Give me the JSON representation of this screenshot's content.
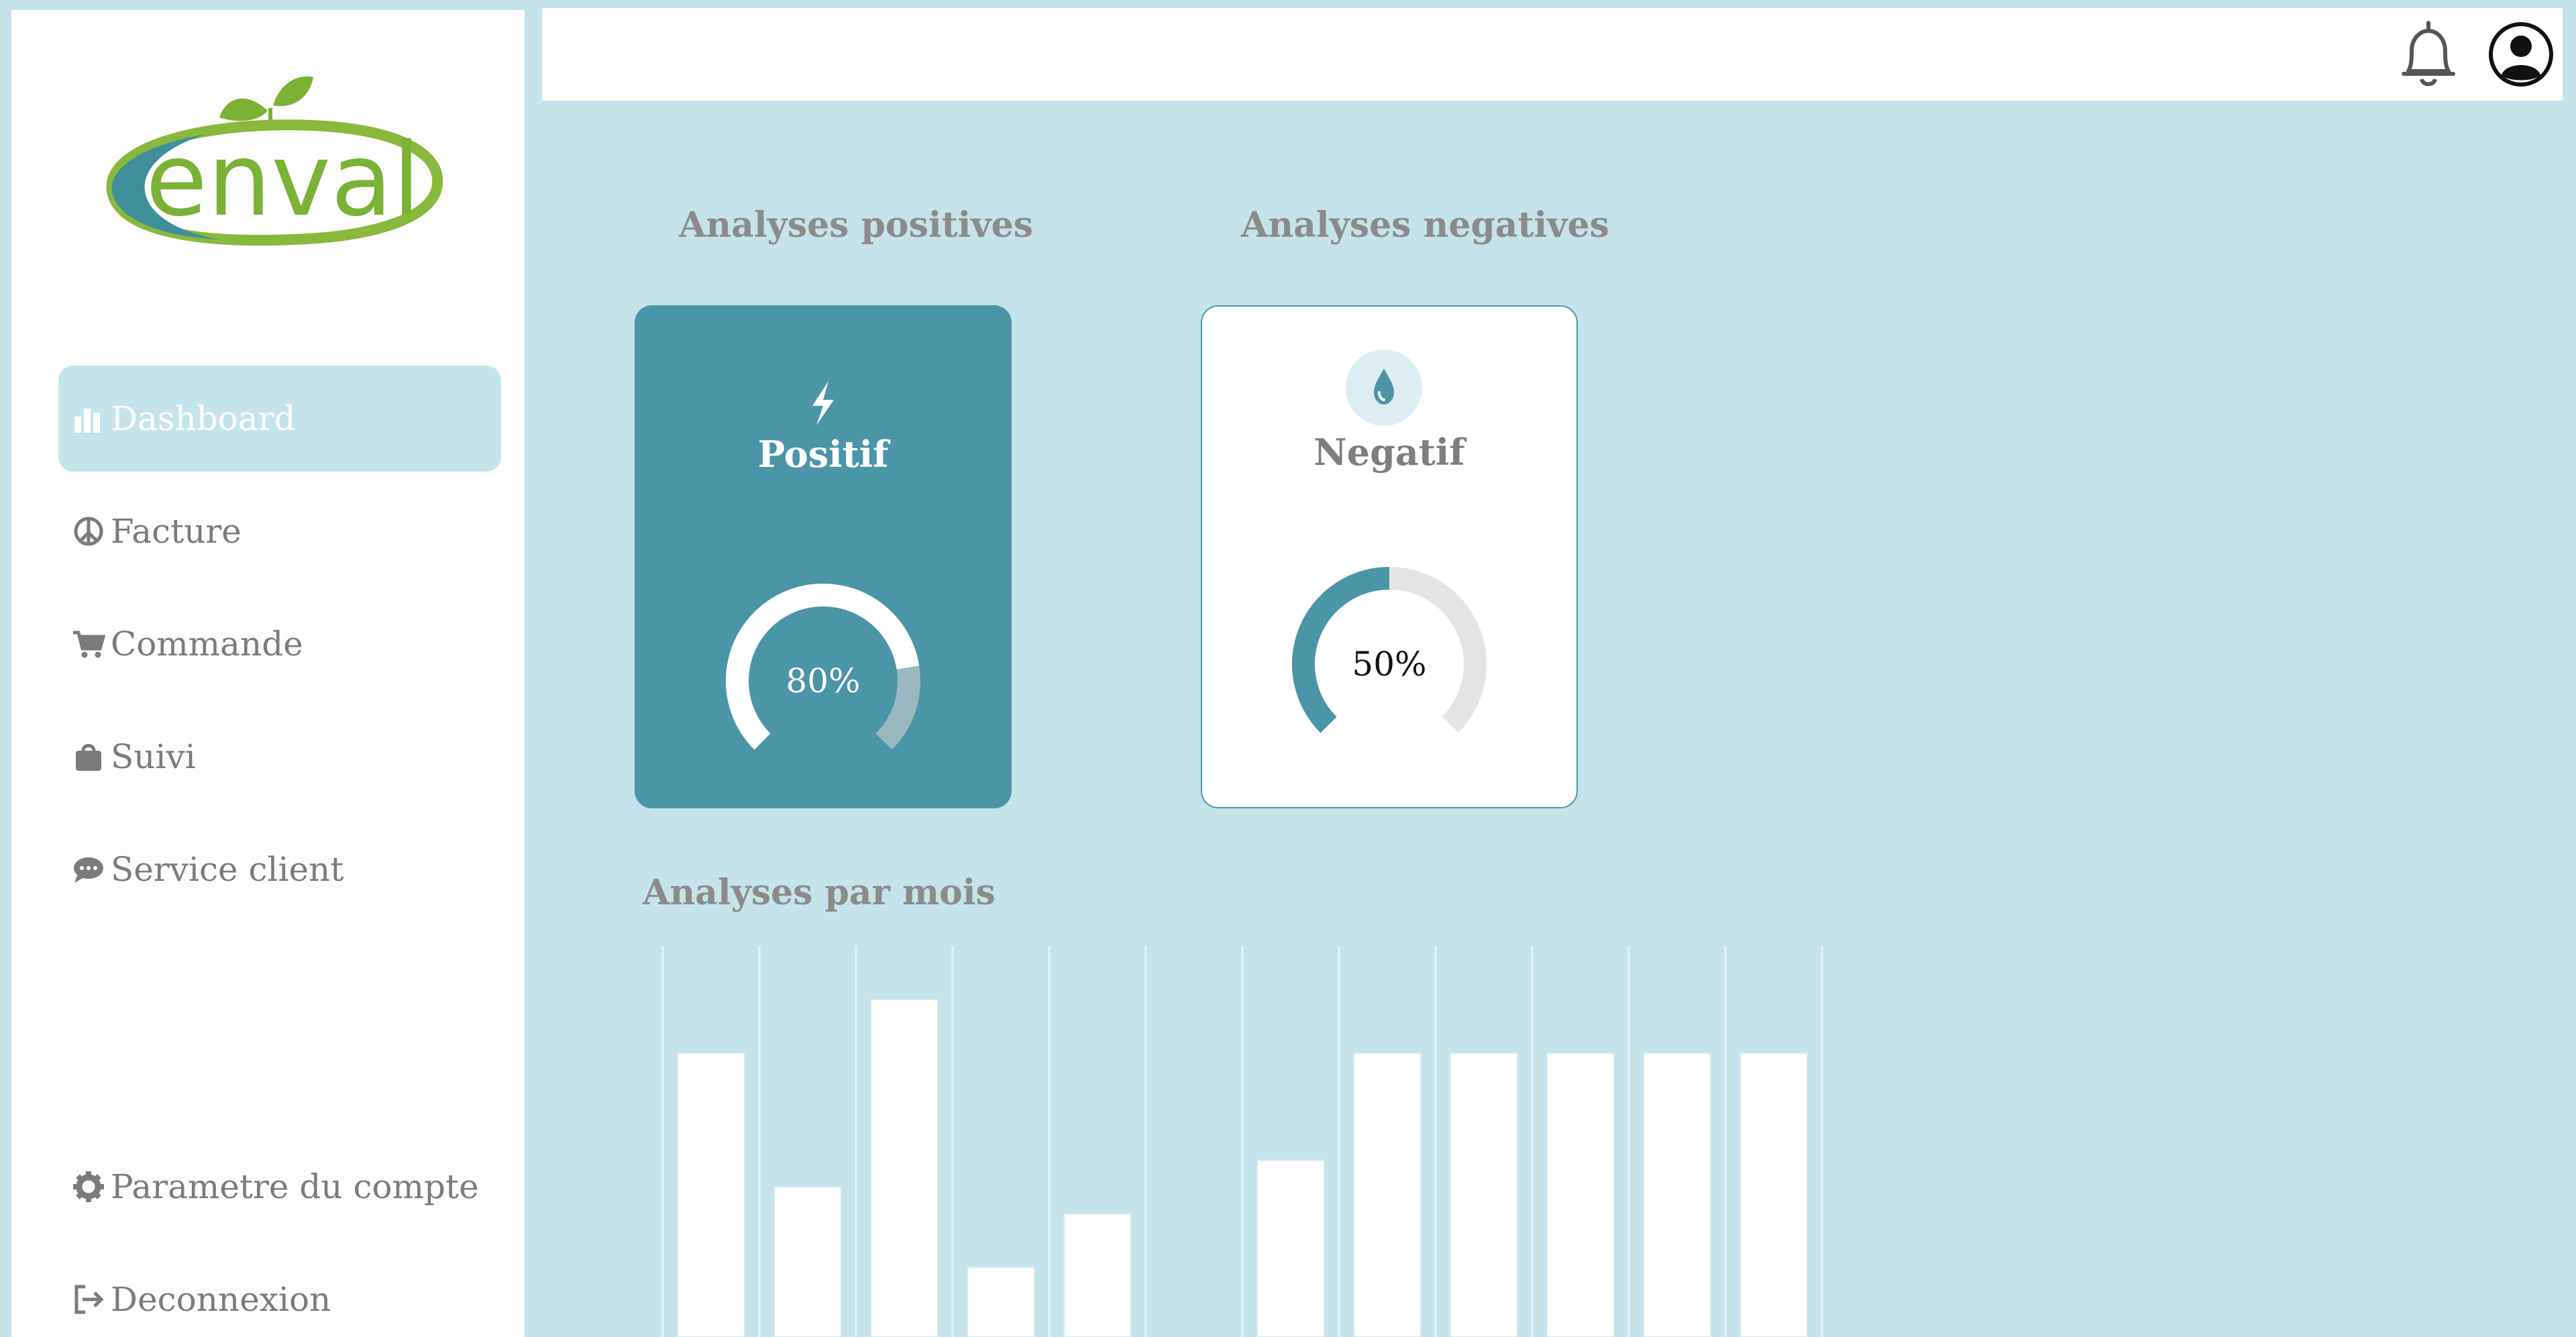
{
  "sidebar": {
    "logo_text": "enval",
    "nav": [
      {
        "label": "Dashboard",
        "icon": "bar-chart-icon",
        "active": true
      },
      {
        "label": "Facture",
        "icon": "peace-icon",
        "active": false
      },
      {
        "label": "Commande",
        "icon": "cart-icon",
        "active": false
      },
      {
        "label": "Suivi",
        "icon": "bag-icon",
        "active": false
      },
      {
        "label": "Service client",
        "icon": "chat-icon",
        "active": false
      }
    ],
    "bottom": [
      {
        "label": "Parametre du compte",
        "icon": "gear-icon"
      },
      {
        "label": "Deconnexion",
        "icon": "logout-icon"
      }
    ]
  },
  "topbar": {
    "icons": [
      "bell-icon",
      "user-avatar-icon"
    ]
  },
  "sections": {
    "positive_heading": "Analyses positives",
    "negative_heading": "Analyses negatives",
    "monthly_heading": "Analyses par mois"
  },
  "cards": {
    "positive": {
      "title": "Positif",
      "percent_label": "80%",
      "value": 0.8,
      "icon": "bolt-icon"
    },
    "negative": {
      "title": "Negatif",
      "percent_label": "50%",
      "value": 0.5,
      "icon": "droplet-icon"
    }
  },
  "colors": {
    "background": "#c5e3ea",
    "accent": "#4b95a8",
    "text_muted": "#8b8b8b",
    "gauge_track_light": "#e4e4e4",
    "gauge_track_dark": "#9ab8c0"
  },
  "chart_data": {
    "type": "bar",
    "categories": [
      "",
      "",
      "",
      "",
      "",
      "",
      "",
      "",
      "",
      "",
      "",
      ""
    ],
    "values": [
      5.3,
      2.8,
      6.3,
      1.3,
      2.3,
      0,
      3.3,
      5.3,
      5.3,
      5.3,
      5.3,
      5.3
    ],
    "ylim": [
      0,
      7.3
    ],
    "grid": true,
    "bar_color": "#ffffff"
  }
}
